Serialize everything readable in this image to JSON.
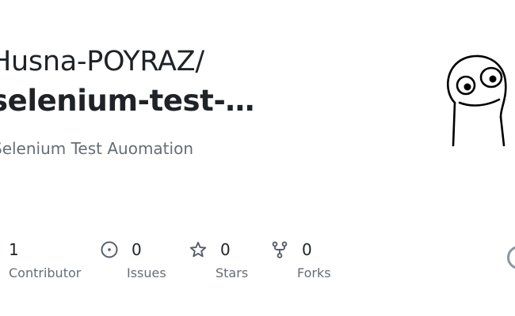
{
  "repo": {
    "owner": "Husna-POYRAZ/",
    "name": "selenium-test-…",
    "description": "Selenium Test Auomation"
  },
  "avatar": {
    "icon": "doodle-face-avatar"
  },
  "stats": {
    "contributors": {
      "count": "1",
      "label": "Contributor"
    },
    "issues": {
      "count": "0",
      "label": "Issues",
      "icon": "issue-opened-icon"
    },
    "stars": {
      "count": "0",
      "label": "Stars",
      "icon": "star-icon"
    },
    "forks": {
      "count": "0",
      "label": "Forks",
      "icon": "repo-forked-icon"
    }
  },
  "colors": {
    "text_primary": "#1f2328",
    "text_secondary": "#656d76",
    "icon_gray": "#57606a"
  },
  "brand_icon": "github-mark-icon"
}
